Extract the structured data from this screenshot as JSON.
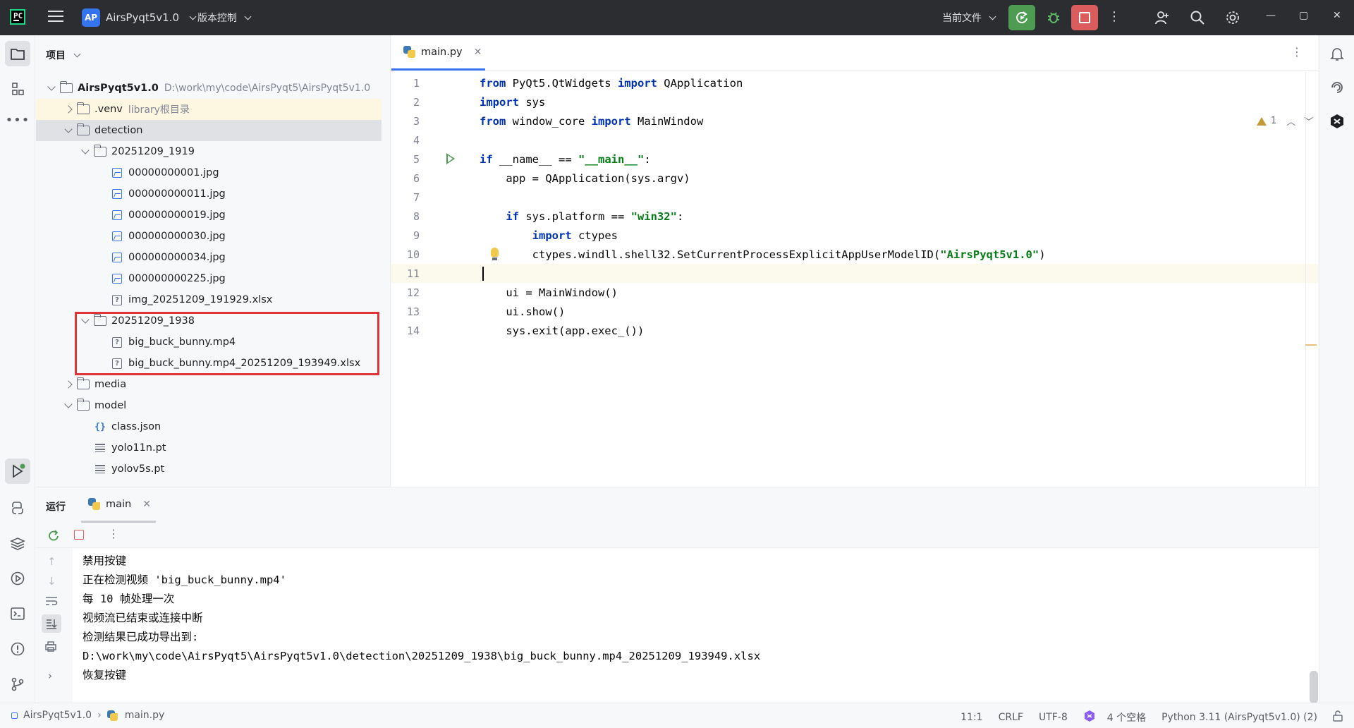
{
  "titlebar": {
    "project_badge": "AP",
    "project_name": "AirsPyqt5v1.0",
    "vcs_label": "版本控制",
    "run_config": "当前文件",
    "more": "⋮",
    "window_controls": [
      "—",
      "▢",
      "✕"
    ]
  },
  "project_panel": {
    "header": "项目",
    "tree": [
      {
        "name": "AirsPyqt5v1.0",
        "hint": "D:\\work\\my\\code\\AirsPyqt5\\AirsPyqt5v1.0"
      },
      {
        "name": ".venv",
        "hint": "library根目录"
      },
      {
        "name": "detection"
      },
      {
        "name": "20251209_1919"
      },
      {
        "name": "00000000001.jpg"
      },
      {
        "name": "000000000011.jpg"
      },
      {
        "name": "000000000019.jpg"
      },
      {
        "name": "000000000030.jpg"
      },
      {
        "name": "000000000034.jpg"
      },
      {
        "name": "000000000225.jpg"
      },
      {
        "name": "img_20251209_191929.xlsx"
      },
      {
        "name": "20251209_1938"
      },
      {
        "name": "big_buck_bunny.mp4"
      },
      {
        "name": "big_buck_bunny.mp4_20251209_193949.xlsx"
      },
      {
        "name": "media"
      },
      {
        "name": "model"
      },
      {
        "name": "class.json"
      },
      {
        "name": "yolo11n.pt"
      },
      {
        "name": "yolov5s.pt"
      }
    ]
  },
  "editor": {
    "tab_label": "main.py",
    "inspection_count": "1",
    "line_numbers": [
      "1",
      "2",
      "3",
      "4",
      "5",
      "6",
      "7",
      "8",
      "9",
      "10",
      "11",
      "12",
      "13",
      "14"
    ]
  },
  "run_panel": {
    "title": "运行",
    "tab_label": "main",
    "console": [
      "禁用按键",
      "正在检测视频 'big_buck_bunny.mp4'",
      "每 10 帧处理一次",
      "视频流已结束或连接中断",
      "检测结果已成功导出到:",
      "D:\\work\\my\\code\\AirsPyqt5\\AirsPyqt5v1.0\\detection\\20251209_1938\\big_buck_bunny.mp4_20251209_193949.xlsx",
      "恢复按键"
    ]
  },
  "statusbar": {
    "project": "AirsPyqt5v1.0",
    "file": "main.py",
    "position": "11:1",
    "line_sep": "CRLF",
    "encoding": "UTF-8",
    "indent": "4 个空格",
    "interpreter": "Python 3.11 (AirsPyqt5v1.0) (2)"
  },
  "colors": {
    "run_button": "#4d9c52",
    "stop_button": "#db5c5c",
    "accent": "#3574f0",
    "highlight_box": "#e0343b",
    "keyword": "#0033b3",
    "string": "#067d17"
  }
}
